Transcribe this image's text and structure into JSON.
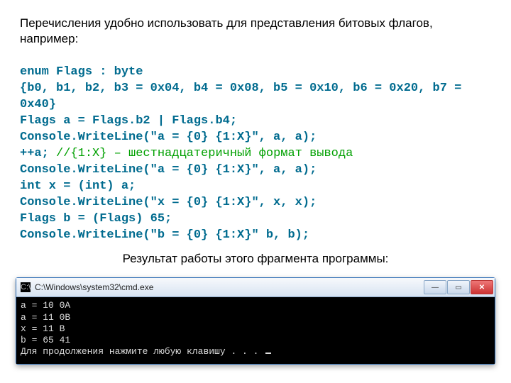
{
  "intro": "Перечисления удобно использовать для представления битовых флагов, например:",
  "code": {
    "l1": "enum Flags : byte",
    "l2": "{b0, b1, b2, b3 = 0x04, b4 = 0x08, b5 = 0x10, b6 = 0x20, b7 = 0x40}",
    "l3": "Flags a = Flags.b2 | Flags.b4;",
    "l4": "Console.WriteLine(\"a = {0} {1:X}\", a, a);",
    "l5a": "++a; ",
    "l5b": "//{1:X} – шестнадцатеричный формат вывода",
    "l6": "Console.WriteLine(\"a = {0} {1:X}\", a, a);",
    "l7": "int x = (int) a;",
    "l8": "Console.WriteLine(\"x = {0} {1:X}\", x, x);",
    "l9": "Flags b = (Flags) 65;",
    "l10": "Console.WriteLine(\"b = {0} {1:X}\" b, b);"
  },
  "result_caption": "Результат работы этого фрагмента программы:",
  "console": {
    "title": "C:\\Windows\\system32\\cmd.exe",
    "lines": {
      "o1": "a = 10 0A",
      "o2": "a = 11 0B",
      "o3": "x = 11 B",
      "o4": "b = 65 41",
      "o5": "Для продолжения нажмите любую клавишу . . . "
    }
  },
  "icons": {
    "cmd": "C:\\",
    "min": "—",
    "max": "▭",
    "close": "✕"
  }
}
